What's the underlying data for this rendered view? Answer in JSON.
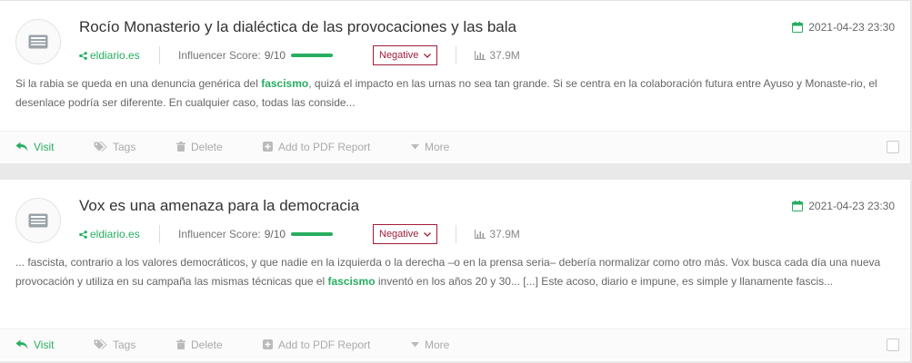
{
  "articles": [
    {
      "title": "Rocío Monasterio y la dialéctica de las provocaciones y las bala",
      "date": "2021-04-23 23:30",
      "source": "eldiario.es",
      "influencer_label": "Influencer Score:",
      "influencer_value": "9/10",
      "sentiment": "Negative",
      "reach": "37.9M",
      "snippet_before": "Si la rabia se queda en una denuncia genérica del ",
      "snippet_highlight": "fascismo",
      "snippet_after": ", quizá el impacto en las urnas no sea tan grande. Si se centra en la colaboración futura entre Ayuso y Monaste-rio, el desenlace podría ser diferente. En cualquier caso, todas las conside..."
    },
    {
      "title": "Vox es una amenaza para la democracia",
      "date": "2021-04-23 23:30",
      "source": "eldiario.es",
      "influencer_label": "Influencer Score:",
      "influencer_value": "9/10",
      "sentiment": "Negative",
      "reach": "37.9M",
      "snippet_before": "... fascista, contrario a los valores democráticos, y que nadie en la izquierda o la derecha –o en la prensa seria– debería normalizar como otro más.  Vox busca cada día una nueva provocación y utiliza en su campaña las mismas técnicas que el ",
      "snippet_highlight": "fascismo",
      "snippet_after": " inventó en los años 20 y 30... [...] Este acoso, diario e impune, es simple y llanamente fascis..."
    }
  ],
  "actions": {
    "visit": "Visit",
    "tags": "Tags",
    "delete": "Delete",
    "pdf": "Add to PDF Report",
    "more": "More"
  },
  "colors": {
    "accent": "#27ae60",
    "negative": "#a01d3a"
  }
}
